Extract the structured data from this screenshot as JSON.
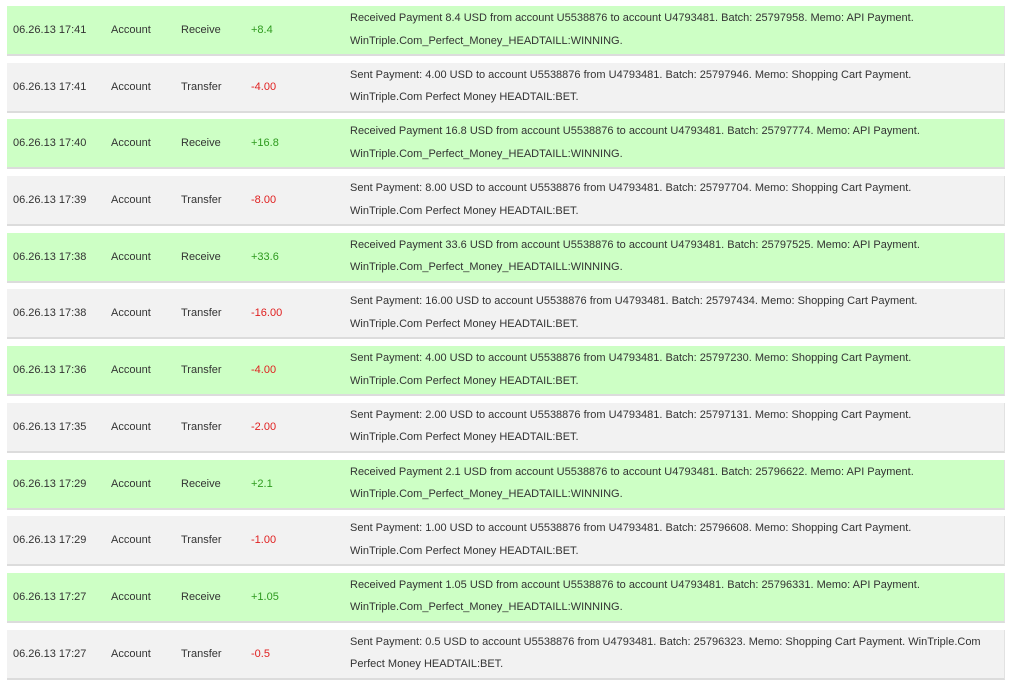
{
  "transactions": [
    {
      "kind": "receive",
      "date": "06.26.13 17:41",
      "account": "Account",
      "type": "Receive",
      "amount": "+8.4",
      "line1": "Received Payment 8.4 USD from account U5538876 to account U4793481. Batch: 25797958. Memo: API Payment.",
      "line2": "WinTriple.Com_Perfect_Money_HEADTAILL:WINNING."
    },
    {
      "kind": "transfer",
      "date": "06.26.13 17:41",
      "account": "Account",
      "type": "Transfer",
      "amount": "-4.00",
      "line1": "Sent Payment: 4.00 USD to account U5538876 from U4793481. Batch: 25797946. Memo: Shopping Cart Payment.",
      "line2": "WinTriple.Com Perfect Money HEADTAIL:BET."
    },
    {
      "kind": "receive",
      "date": "06.26.13 17:40",
      "account": "Account",
      "type": "Receive",
      "amount": "+16.8",
      "line1": "Received Payment 16.8 USD from account U5538876 to account U4793481. Batch: 25797774. Memo: API Payment.",
      "line2": "WinTriple.Com_Perfect_Money_HEADTAILL:WINNING."
    },
    {
      "kind": "transfer",
      "date": "06.26.13 17:39",
      "account": "Account",
      "type": "Transfer",
      "amount": "-8.00",
      "line1": "Sent Payment: 8.00 USD to account U5538876 from U4793481. Batch: 25797704. Memo: Shopping Cart Payment.",
      "line2": "WinTriple.Com Perfect Money HEADTAIL:BET."
    },
    {
      "kind": "receive",
      "date": "06.26.13 17:38",
      "account": "Account",
      "type": "Receive",
      "amount": "+33.6",
      "line1": "Received Payment 33.6 USD from account U5538876 to account U4793481. Batch: 25797525. Memo: API Payment.",
      "line2": "WinTriple.Com_Perfect_Money_HEADTAILL:WINNING."
    },
    {
      "kind": "transfer",
      "date": "06.26.13 17:38",
      "account": "Account",
      "type": "Transfer",
      "amount": "-16.00",
      "line1": "Sent Payment: 16.00 USD to account U5538876 from U4793481. Batch: 25797434. Memo: Shopping Cart Payment.",
      "line2": "WinTriple.Com Perfect Money HEADTAIL:BET."
    },
    {
      "kind": "receive",
      "date": "06.26.13 17:36",
      "account": "Account",
      "type": "Transfer",
      "amount": "-4.00",
      "line1": "Sent Payment: 4.00 USD to account U5538876 from U4793481. Batch: 25797230. Memo: Shopping Cart Payment.",
      "line2": "WinTriple.Com Perfect Money HEADTAIL:BET."
    },
    {
      "kind": "transfer",
      "date": "06.26.13 17:35",
      "account": "Account",
      "type": "Transfer",
      "amount": "-2.00",
      "line1": "Sent Payment: 2.00 USD to account U5538876 from U4793481. Batch: 25797131. Memo: Shopping Cart Payment.",
      "line2": "WinTriple.Com Perfect Money HEADTAIL:BET."
    },
    {
      "kind": "receive",
      "date": "06.26.13 17:29",
      "account": "Account",
      "type": "Receive",
      "amount": "+2.1",
      "line1": "Received Payment 2.1 USD from account U5538876 to account U4793481. Batch: 25796622. Memo: API Payment.",
      "line2": "WinTriple.Com_Perfect_Money_HEADTAILL:WINNING."
    },
    {
      "kind": "transfer",
      "date": "06.26.13 17:29",
      "account": "Account",
      "type": "Transfer",
      "amount": "-1.00",
      "line1": "Sent Payment: 1.00 USD to account U5538876 from U4793481. Batch: 25796608. Memo: Shopping Cart Payment.",
      "line2": "WinTriple.Com Perfect Money HEADTAIL:BET."
    },
    {
      "kind": "receive",
      "date": "06.26.13 17:27",
      "account": "Account",
      "type": "Receive",
      "amount": "+1.05",
      "line1": "Received Payment 1.05 USD from account U5538876 to account U4793481. Batch: 25796331. Memo: API Payment.",
      "line2": "WinTriple.Com_Perfect_Money_HEADTAILL:WINNING."
    },
    {
      "kind": "transfer",
      "date": "06.26.13 17:27",
      "account": "Account",
      "type": "Transfer",
      "amount": "-0.5",
      "line1": "Sent Payment: 0.5 USD to account U5538876 from U4793481. Batch: 25796323. Memo: Shopping Cart Payment. WinTriple.Com",
      "line2": "Perfect Money HEADTAIL:BET."
    }
  ],
  "colors": {
    "receive_row_bg": "#cdffc5",
    "transfer_row_bg": "#f2f2f2",
    "positive_amount": "#2e9a1e",
    "negative_amount": "#e02020"
  }
}
